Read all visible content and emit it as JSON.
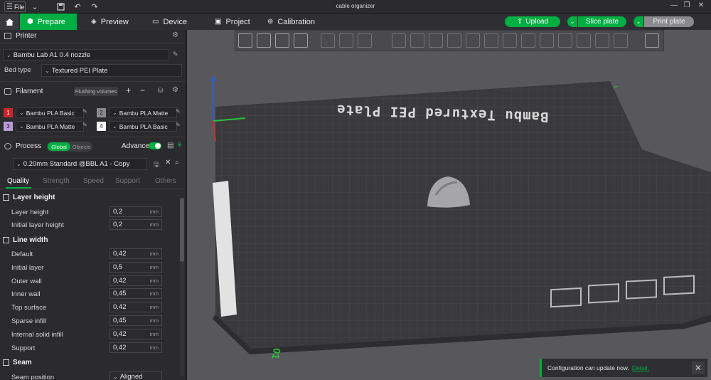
{
  "window": {
    "title": "cable organizer"
  },
  "titlebar": {
    "file_label": "File"
  },
  "tabs": [
    {
      "label": "Prepare",
      "active": true
    },
    {
      "label": "Preview"
    },
    {
      "label": "Device"
    },
    {
      "label": "Project"
    },
    {
      "label": "Calibration"
    }
  ],
  "actions": {
    "upload": "Upload",
    "slice": "Slice plate",
    "print": "Print plate"
  },
  "printer": {
    "section_label": "Printer",
    "name": "Bambu Lab A1 0.4 nozzle",
    "bed_type_label": "Bed type",
    "bed_type": "Textured PEI Plate"
  },
  "filament": {
    "section_label": "Filament",
    "flushing_label": "Flushing volumes",
    "slots": [
      {
        "num": "1",
        "name": "Bambu PLA Basic",
        "color": "#c8252c"
      },
      {
        "num": "2",
        "name": "Bambu PLA Matte",
        "color": "#8a8a8a"
      },
      {
        "num": "3",
        "name": "Bambu PLA Matte",
        "color": "#b79bd8"
      },
      {
        "num": "4",
        "name": "Bambu PLA Basic",
        "color": "#ffffff"
      }
    ]
  },
  "process": {
    "section_label": "Process",
    "global_label": "Global",
    "objects_label": "Objects",
    "advance_label": "Advance",
    "preset": "0.20mm Standard @BBL A1 - Copy",
    "subtabs": [
      "Quality",
      "Strength",
      "Speed",
      "Support",
      "Others"
    ]
  },
  "settings": {
    "layer_height_group": "Layer height",
    "layer_height": {
      "label": "Layer height",
      "value": "0,2",
      "unit": "mm"
    },
    "initial_layer_height": {
      "label": "Initial layer height",
      "value": "0,2",
      "unit": "mm"
    },
    "line_width_group": "Line width",
    "line_width": [
      {
        "label": "Default",
        "value": "0,42",
        "unit": "mm"
      },
      {
        "label": "Initial layer",
        "value": "0,5",
        "unit": "mm"
      },
      {
        "label": "Outer wall",
        "value": "0,42",
        "unit": "mm"
      },
      {
        "label": "Inner wall",
        "value": "0,45",
        "unit": "mm"
      },
      {
        "label": "Top surface",
        "value": "0,42",
        "unit": "mm"
      },
      {
        "label": "Sparse infill",
        "value": "0,45",
        "unit": "mm"
      },
      {
        "label": "Internal solid infill",
        "value": "0,42",
        "unit": "mm"
      },
      {
        "label": "Support",
        "value": "0,42",
        "unit": "mm"
      }
    ],
    "seam_group": "Seam",
    "seam_position": {
      "label": "Seam position",
      "value": "Aligned"
    }
  },
  "plate": {
    "label": "Bambu Textured PEI Plate",
    "number": "01"
  },
  "notification": {
    "text": "Configuration can update now.",
    "link": "Detail."
  },
  "colors": {
    "accent": "#00ae42",
    "panel": "#2b2b2e",
    "viewport": "#58585c",
    "plate": "#3a3a3d"
  }
}
